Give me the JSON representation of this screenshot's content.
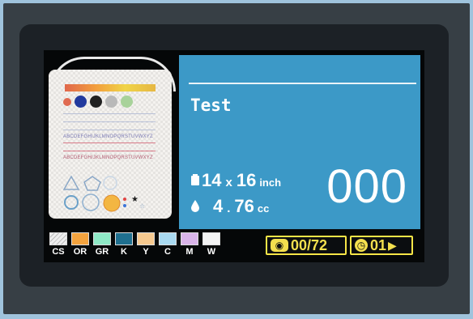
{
  "job": {
    "title": "Test"
  },
  "size": {
    "width": "14",
    "x": "x",
    "height": "16",
    "unit": "inch",
    "icon": "shirt-icon"
  },
  "ink": {
    "whole": "4",
    "dot": ".",
    "frac": "76",
    "unit": "cc",
    "icon": "ink-drop-icon"
  },
  "count": "000",
  "swatches": [
    {
      "label": "CS",
      "color": "#f0f0f0"
    },
    {
      "label": "OR",
      "color": "#f4a33e"
    },
    {
      "label": "GR",
      "color": "#8fe9c6"
    },
    {
      "label": "K",
      "color": "#1f6f8f"
    },
    {
      "label": "Y",
      "color": "#f6c98f"
    },
    {
      "label": "C",
      "color": "#a9d9f0"
    },
    {
      "label": "M",
      "color": "#d9b4e8"
    },
    {
      "label": "W",
      "color": "#f3f3f3"
    }
  ],
  "status": {
    "progress": "00/72",
    "progress_icon": "eye-icon",
    "page": "01",
    "page_icon": "clock-icon",
    "play_icon": "play-icon"
  },
  "preview": {
    "line1": "ABCDEFGHIJKLMNOPQRSTUVWXYZ",
    "line2": "ABCDEFGHIJKLMNOPQRSTUVWXYZ"
  }
}
